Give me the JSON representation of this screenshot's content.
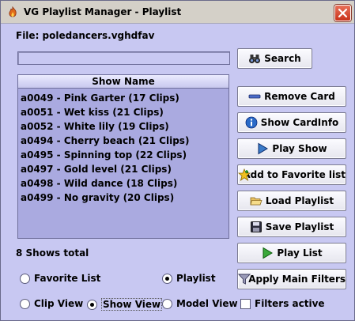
{
  "window": {
    "title": "VG Playlist Manager - Playlist",
    "icons": {
      "app": "flame-icon",
      "close": "close-icon"
    }
  },
  "file": {
    "label": "File: poledancers.vghdfav"
  },
  "search": {
    "value": "",
    "button_label": "Search",
    "icon": "binoculars-icon"
  },
  "list": {
    "header": "Show Name",
    "rows": [
      "a0049 - Pink Garter (17 Clips)",
      "a0051 - Wet kiss (21 Clips)",
      "a0052 - White lily (19 Clips)",
      "a0494 - Cherry beach (21 Clips)",
      "a0495 - Spinning top (22 Clips)",
      "a0497 - Gold level (21 Clips)",
      "a0498 - Wild dance (18 Clips)",
      "a0499 - No gravity (20 Clips)"
    ],
    "total": "8 Shows total"
  },
  "actions": {
    "remove_card": "Remove Card",
    "show_cardinfo": "Show CardInfo",
    "play_show": "Play Show",
    "add_favorite": "Add to Favorite list",
    "load_playlist": "Load Playlist",
    "save_playlist": "Save Playlist",
    "play_list": "Play List",
    "apply_filters": "Apply Main Filters"
  },
  "source": {
    "favorite_list": "Favorite List",
    "playlist": "Playlist",
    "selected": "Playlist"
  },
  "view": {
    "clip_view": "Clip View",
    "show_view": "Show View",
    "model_view": "Model View",
    "selected": "Show View"
  },
  "filters_active": {
    "label": "Filters active",
    "checked": false
  },
  "colors": {
    "window_bg": "#c8c8f2",
    "list_bg": "#aaaae0",
    "close_button": "#d84a2e",
    "play_green": "#3aa83a",
    "info_blue": "#2a6ac8"
  }
}
